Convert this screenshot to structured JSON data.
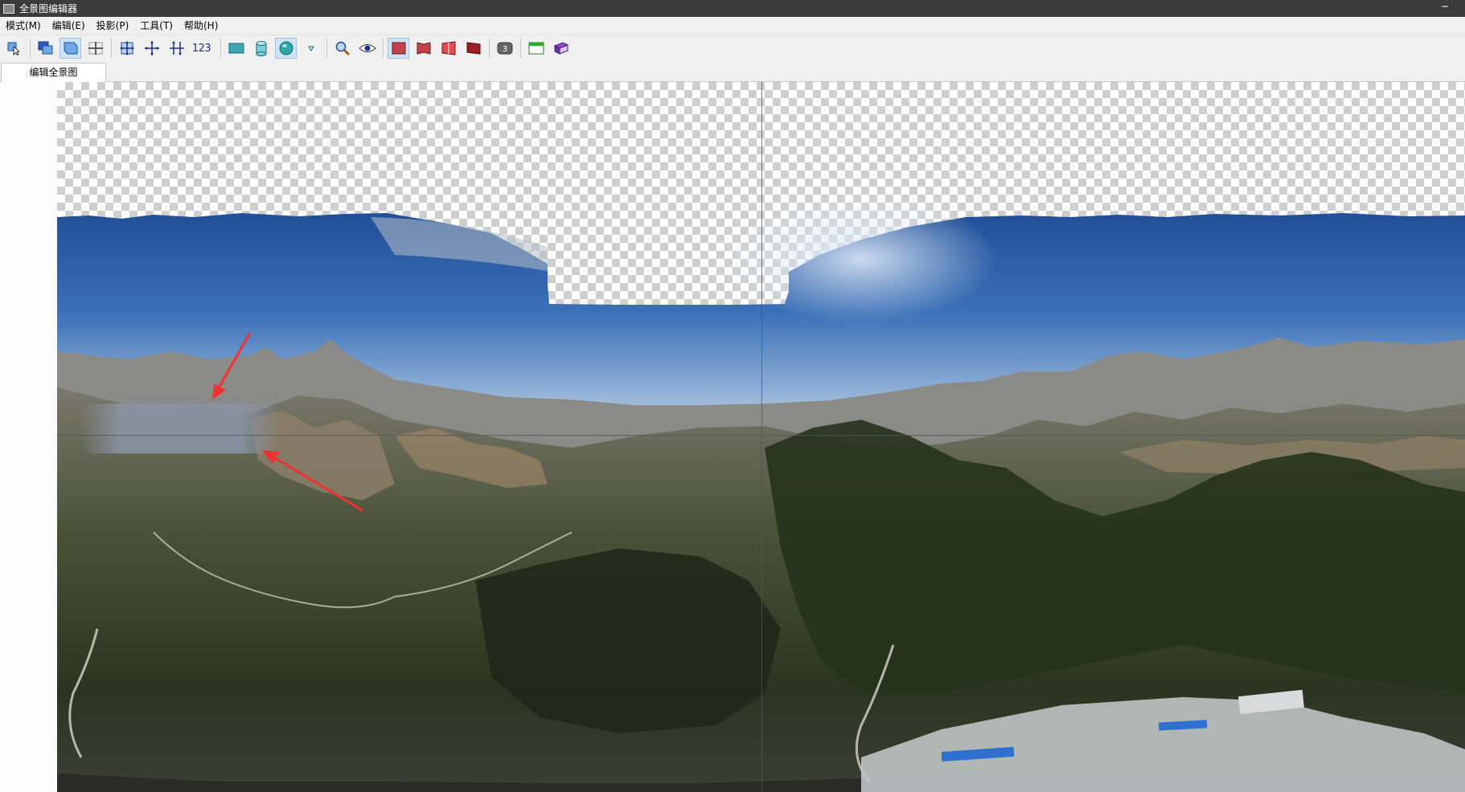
{
  "window": {
    "title": "全景图编辑器"
  },
  "menu": {
    "items": [
      "模式(M)",
      "编辑(E)",
      "投影(P)",
      "工具(T)",
      "帮助(H)"
    ]
  },
  "toolbar": {
    "numbers_label": "123",
    "layer_badge": "3",
    "icons": [
      "select-arrow-icon",
      "images-icon",
      "panorama-icon",
      "crosshair-icon",
      "move-icon",
      "center-icon",
      "straighten-icon",
      "numbers-icon",
      "rectilinear-icon",
      "cylinder-icon",
      "sphere-icon",
      "dropdown-icon",
      "zoom-icon",
      "preview-eye-icon",
      "projection-flat-icon",
      "projection-fold-icon",
      "projection-mirror-icon",
      "projection-dark-icon",
      "layer-badge-icon",
      "window-icon",
      "book-icon"
    ]
  },
  "tabs": {
    "active": "编辑全景图"
  },
  "colors": {
    "sky_top": "#2b5ca4",
    "sky_bottom": "#a9bfd8",
    "mountain": "#6f6a5e",
    "forest": "#2f3b22",
    "arrow": "#ee3333",
    "toolbar_active": "#cfe4f7"
  }
}
